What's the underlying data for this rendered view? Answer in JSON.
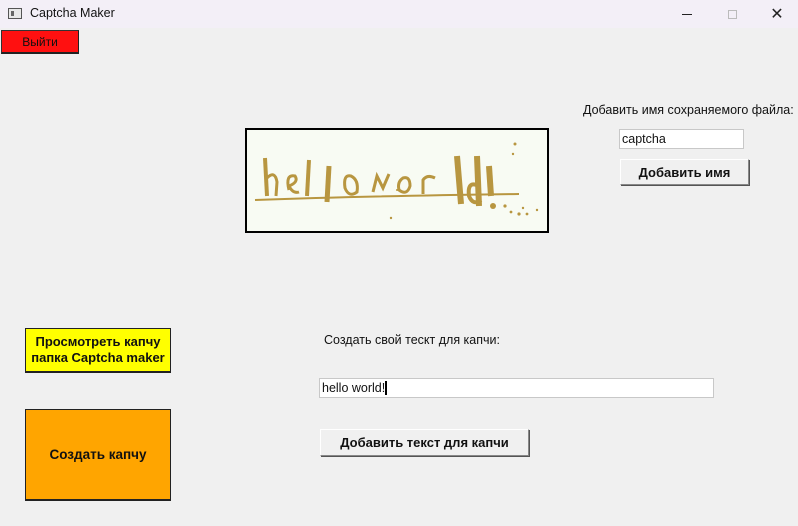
{
  "window": {
    "title": "Captcha Maker",
    "min_icon": "minimize-icon",
    "max_icon": "maximize-icon",
    "close_icon": "close-icon"
  },
  "exit_button": {
    "label": "Выйти",
    "color": "#ff1010"
  },
  "captcha_image": {
    "text": "hello world!",
    "ink_color": "#b89640"
  },
  "filename": {
    "label": "Добавить имя сохраняемого файла:",
    "value": "captcha",
    "button": "Добавить имя"
  },
  "captcha_text": {
    "label": "Создать свой тескт для капчи:",
    "value": "hello world!",
    "button": "Добавить текст для капчи"
  },
  "view_button": {
    "line1": "Просмотреть капчу",
    "line2": "папка Captcha maker",
    "color": "#ffff00"
  },
  "create_button": {
    "label": "Создать капчу",
    "color": "#ffa500"
  }
}
